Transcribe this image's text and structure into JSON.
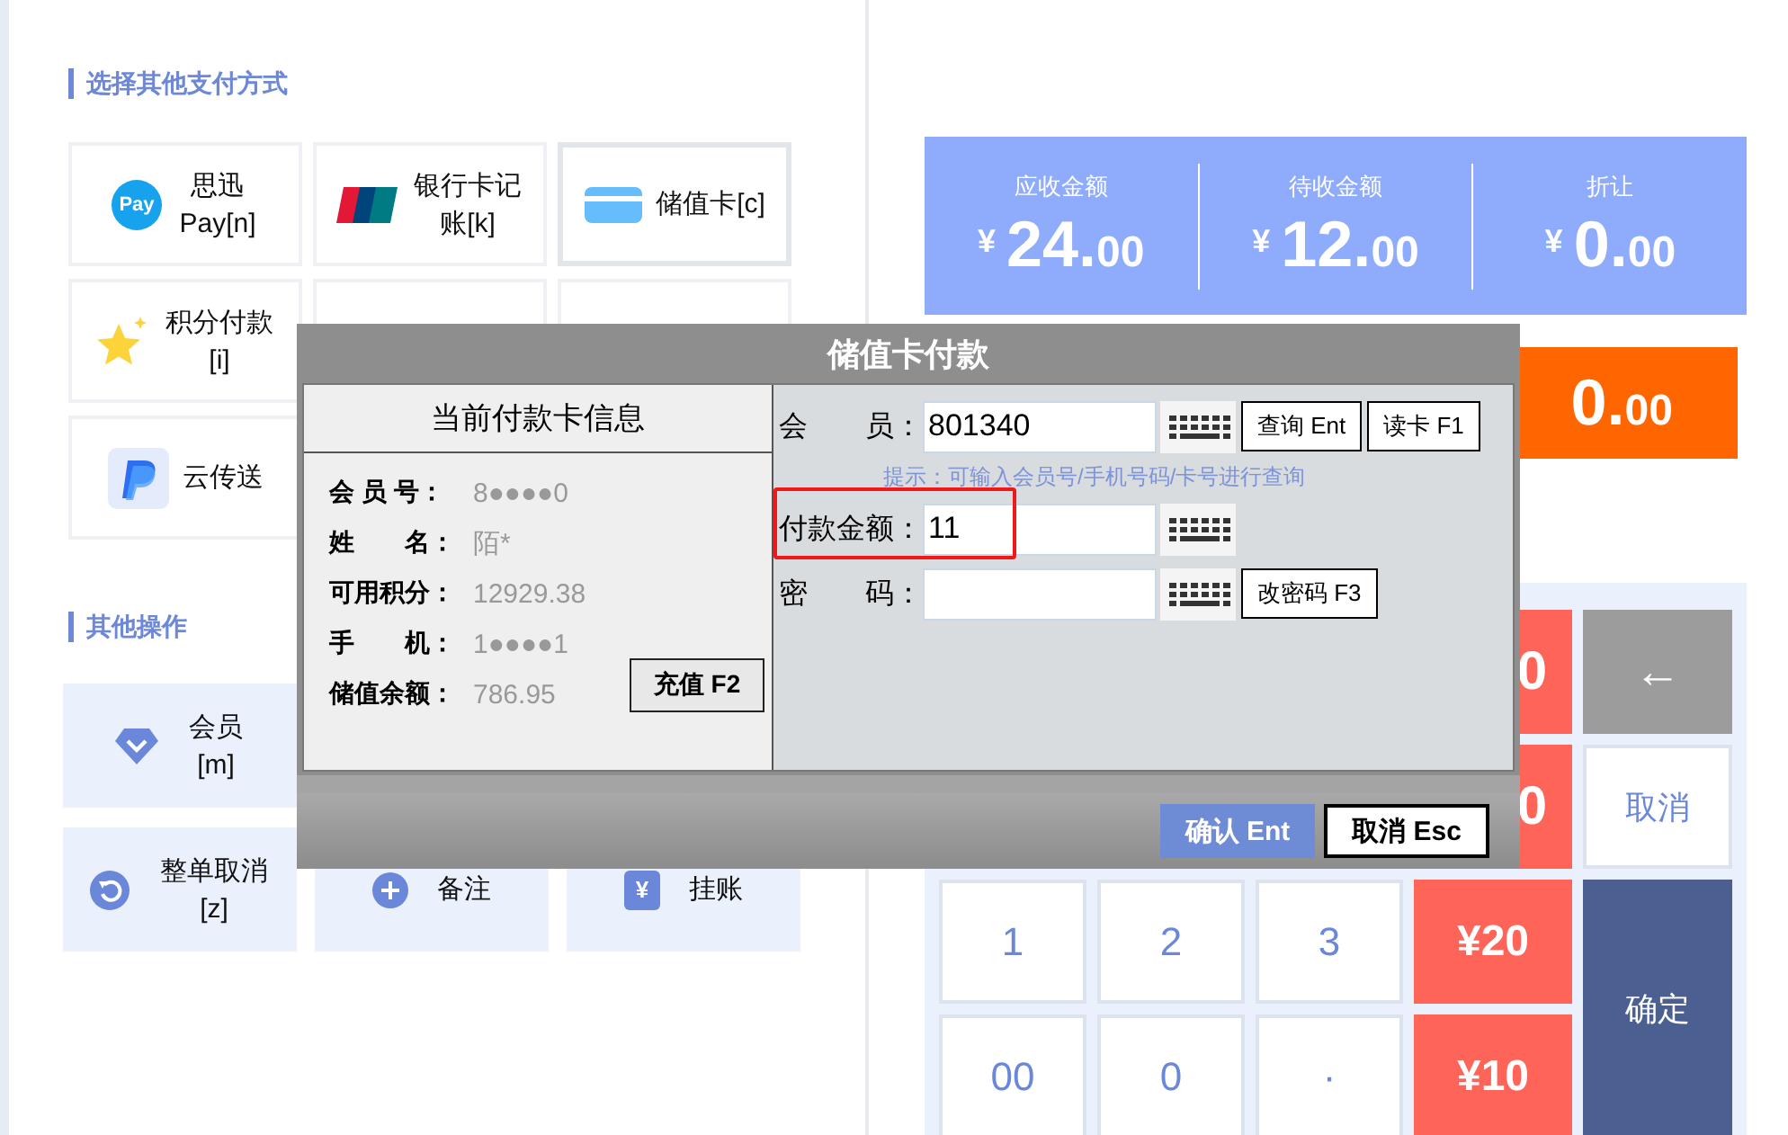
{
  "payment_section": {
    "title": "选择其他支付方式"
  },
  "payment_methods": [
    {
      "kind": "method",
      "icon_text": "Pay",
      "label": "思迅Pay[n]",
      "selected": false
    },
    {
      "kind": "method",
      "label": "银行卡记账[k]",
      "selected": false
    },
    {
      "kind": "method",
      "label": "储值卡[c]",
      "selected": true
    },
    {
      "kind": "method",
      "label": "积分付款[i]",
      "selected": false
    },
    {
      "kind": "blank"
    },
    {
      "kind": "blank"
    },
    {
      "kind": "method",
      "label": "云传送",
      "selected": false
    }
  ],
  "operations_section": {
    "title": "其他操作"
  },
  "operations": [
    {
      "kind": "op",
      "label": "会员[m]"
    },
    {
      "kind": "blank"
    },
    {
      "kind": "blank"
    },
    {
      "kind": "op",
      "label": "整单取消[z]"
    },
    {
      "kind": "op",
      "label": "备注"
    },
    {
      "kind": "op",
      "icon_text": "¥",
      "label": "挂账"
    }
  ],
  "summary": [
    {
      "label": "应收金额",
      "currency": "¥",
      "integer": "24.",
      "decimal": "00"
    },
    {
      "label": "待收金额",
      "currency": "¥",
      "integer": "12.",
      "decimal": "00"
    },
    {
      "label": "折让",
      "currency": "¥",
      "integer": "0.",
      "decimal": "00"
    }
  ],
  "change": {
    "integer": "0.",
    "decimal": "00"
  },
  "keypad": [
    {
      "kind": "cut",
      "label": "0"
    },
    {
      "kind": "gray",
      "label": "←"
    },
    {
      "kind": "cut",
      "label": "0"
    },
    {
      "kind": "white",
      "label": "取消"
    },
    {
      "kind": "num",
      "label": "1"
    },
    {
      "kind": "num",
      "label": "2"
    },
    {
      "kind": "num",
      "label": "3"
    },
    {
      "kind": "red",
      "label": "¥20"
    },
    {
      "kind": "confirm",
      "label": "确定"
    },
    {
      "kind": "num",
      "label": "00"
    },
    {
      "kind": "num",
      "label": "0"
    },
    {
      "kind": "num",
      "label": "·"
    },
    {
      "kind": "red",
      "label": "¥10"
    }
  ],
  "dialog": {
    "title": "储值卡付款",
    "card_info": {
      "title": "当前付款卡信息",
      "rows": [
        {
          "label": "会 员 号：",
          "value": "8●●●●0"
        },
        {
          "label": "姓　　名：",
          "value": "陌*"
        },
        {
          "label": "可用积分：",
          "value": "12929.38"
        },
        {
          "label": "手　　机：",
          "value": "1●●●●1"
        },
        {
          "label": "储值余额：",
          "value": "786.95"
        }
      ],
      "recharge_button": "充值 F2"
    },
    "fields": [
      {
        "label": "会　　员：",
        "value": "801340",
        "highlighted": false,
        "buttons": [
          "查询 Ent",
          "读卡 F1"
        ],
        "hint": "提示：可输入会员号/手机号码/卡号进行查询"
      },
      {
        "label": "付款金额：",
        "value": "11",
        "highlighted": true
      },
      {
        "label": "密　　码：",
        "highlighted": false,
        "buttons": [
          "改密码 F3"
        ]
      }
    ],
    "confirm_button": "确认 Ent",
    "cancel_button": "取消 Esc"
  }
}
